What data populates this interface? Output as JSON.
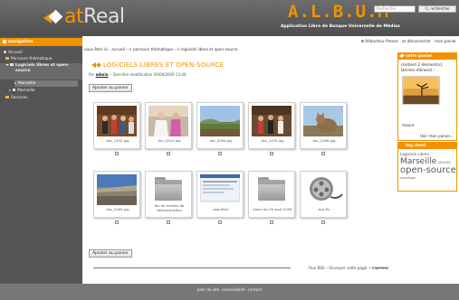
{
  "header": {
    "logo_part1": "at",
    "logo_part2": "Real",
    "album_title": "A.L.B.U.M",
    "album_subtitle": "Application Libre de Banque Universelle de Médias",
    "search_placeholder": "Recherche",
    "search_button": "rechercher"
  },
  "user_bar": {
    "role": "Rédacteur Presse",
    "logout": "se déconnecter",
    "my_basket": "mon panier"
  },
  "sidebar": {
    "heading": "navigation",
    "items": [
      {
        "label": "Accueil"
      },
      {
        "label": "Parcours thématique"
      },
      {
        "label": "Logiciels libres et open-source"
      },
      {
        "label": "Marseille"
      },
      {
        "label": "Marseille"
      },
      {
        "label": "Services"
      }
    ]
  },
  "breadcrumb": "vous êtes ici : accueil --> parcours thématique --> logiciels libres et open-source",
  "page": {
    "title": "LOGICIELS LIBRES ET OPEN-SOURCE",
    "meta_prefix": "Par",
    "author": "admin",
    "meta_suffix": "-- Dernière modification 26/06/2009 13:40",
    "add_to_basket_top": "Ajouter au panier",
    "add_to_basket_bottom": "Ajouter au panier"
  },
  "thumbnails": [
    {
      "caption": "dsc_1432.jpg",
      "kind": "photo-group"
    },
    {
      "caption": "dsc_0510.jpg",
      "kind": "photo-bride"
    },
    {
      "caption": "dsc_2094.jpg",
      "kind": "photo-landscape"
    },
    {
      "caption": "dsc_1435.jpg",
      "kind": "photo-group"
    },
    {
      "caption": "dsc_2096.jpg",
      "kind": "photo-cat"
    },
    {
      "caption": "dsc_2069.jpg",
      "kind": "photo-city"
    },
    {
      "caption": "Jeu de médias de démonstration",
      "kind": "folder"
    },
    {
      "caption": "openElec",
      "kind": "screenshot"
    },
    {
      "caption": "Salon du 26 aout 2009",
      "kind": "folder"
    },
    {
      "caption": "bus.flv",
      "kind": "film-reel"
    }
  ],
  "footer_actions": {
    "rss": "Flux RSS",
    "send": "Envoyer cette page",
    "print": "Imprimer"
  },
  "basket_panel": {
    "title": "votre panier",
    "line1": "contient 2 élément(s).",
    "line2": "Dernier élément :",
    "item_caption": "maure",
    "view_link": "Voir mon panier..."
  },
  "tag_panel": {
    "title": "tag cloud",
    "tags": [
      "Logiciels Libres",
      "Marseille",
      "ORLUDS",
      "open-source",
      "reportage"
    ]
  },
  "site_footer": {
    "plan": "plan du site",
    "access": "accessibilité",
    "contact": "contact"
  },
  "colors": {
    "accent": "#f39200",
    "header_bg": "#5c5c5c",
    "sidebar_bg": "#555555",
    "footer_bg": "#777777"
  }
}
